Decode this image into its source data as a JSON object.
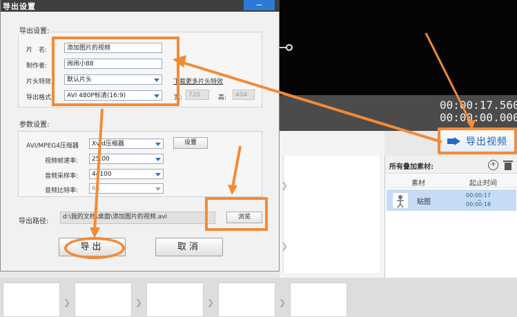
{
  "dialog": {
    "title": "导出设置",
    "close_label": "−",
    "export_group": {
      "title": "导出设置:",
      "name_label": "片　名:",
      "name_value": "添加图片的视频",
      "author_label": "制作者:",
      "author_value": "闹闹小88",
      "opening_label": "片头特效:",
      "opening_value": "默认片头",
      "download_link": "下载更多片头特效",
      "format_label": "导出格式:",
      "format_value": "AVI 480P标清(16:9)",
      "width_label": "宽:",
      "width_value": "720",
      "height_label": "高:",
      "height_value": "404"
    },
    "param_group": {
      "title": "参数设置:",
      "codec_label": "AVI/MPEG4压缩器",
      "codec_value": "Xvid压缩器",
      "settings_button": "设置",
      "fps_label": "视频帧速率:",
      "fps_value": "25.00",
      "sample_label": "音频采样率:",
      "sample_value": "44100",
      "bitrate_label": "音频比特率:",
      "bitrate_value": "64"
    },
    "path_label": "导出路径:",
    "path_value": "d:\\我的文档\\桌面\\添加图片的视频.avi",
    "browse_button": "浏览",
    "export_button": "导出",
    "cancel_button": "取消"
  },
  "editor": {
    "time_current": "00:00:17.560",
    "time_total": "00:00:00.000",
    "export_video_button": "导出视频",
    "overlay_panel": {
      "title": "所有叠加素材:",
      "add_icon": "add-circle-icon",
      "delete_icon": "trash-icon",
      "col_material": "素材",
      "col_time": "起止时间",
      "rows": [
        {
          "name": "贴图",
          "start": "00:00:17",
          "tilde": "~",
          "end": "00:00:18"
        }
      ]
    }
  },
  "colors": {
    "annotation": "#f58a35",
    "accent_blue": "#2d7ad4",
    "dialog_title_bg": "#3f3f3f"
  }
}
